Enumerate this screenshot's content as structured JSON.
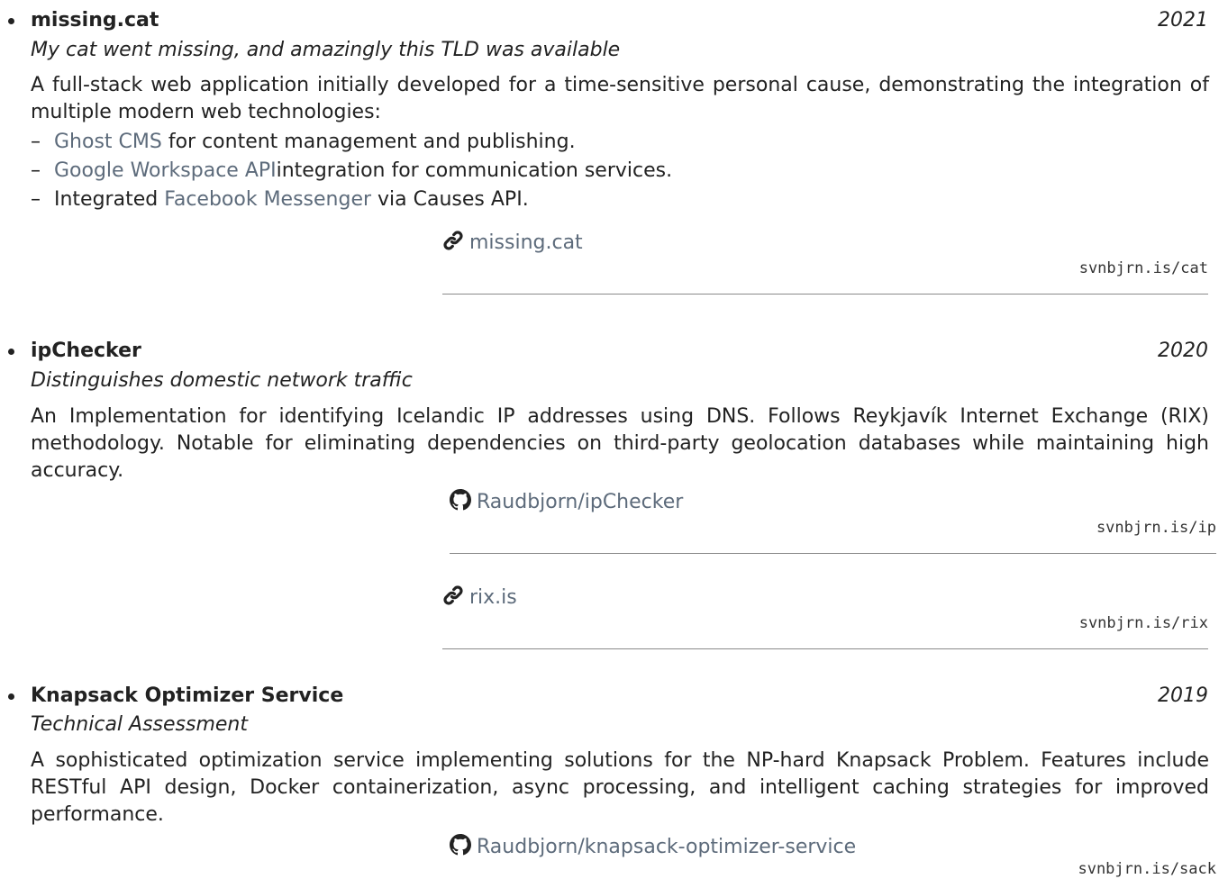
{
  "projects": [
    {
      "title": "missing.cat",
      "year": "2021",
      "subtitle": "My cat went missing, and amazingly this TLD was available",
      "description": "A full-stack web application initially developed for a time-sensitive personal cause, demonstrating the integration of multiple modern web technologies:",
      "bullets": [
        {
          "dash": "–",
          "pre": "",
          "link": "Ghost CMS",
          "post": " for content management and publishing."
        },
        {
          "dash": "–",
          "pre": "",
          "link": "Google Workspace API",
          "post": "integration for communication services."
        },
        {
          "dash": "–",
          "pre": "Integrated ",
          "link": "Facebook Messenger",
          "post": " via Causes API."
        }
      ],
      "links": [
        {
          "icon": "link-icon",
          "text": "missing.cat",
          "short": "svnbjrn.is/cat"
        }
      ]
    },
    {
      "title": "ipChecker",
      "year": "2020",
      "subtitle": "Distinguishes domestic network traffic",
      "description": "An Implementation for identifying Icelandic IP addresses using DNS. Follows Reykjavík Internet Exchange (RIX) methodology.  Notable for eliminating dependencies on third-party geolocation databases while maintaining high accuracy.",
      "links": [
        {
          "icon": "github-icon",
          "text": "Raudbjorn/ipChecker",
          "short": "svnbjrn.is/ip"
        },
        {
          "icon": "link-icon",
          "text": "rix.is",
          "short": "svnbjrn.is/rix"
        }
      ]
    },
    {
      "title": "Knapsack Optimizer Service",
      "year": "2019",
      "subtitle": "Technical Assessment",
      "description": "A sophisticated optimization service implementing solutions for the NP-hard Knapsack Problem.  Features include RESTful API design, Docker containerization, async processing, and intelligent caching strategies for improved performance.",
      "links": [
        {
          "icon": "github-icon",
          "text": "Raudbjorn/knapsack-optimizer-service",
          "short": "svnbjrn.is/sack"
        }
      ]
    }
  ],
  "colors": {
    "text": "#222222",
    "link": "#5d6b7b",
    "rule": "#8a8a8a"
  }
}
